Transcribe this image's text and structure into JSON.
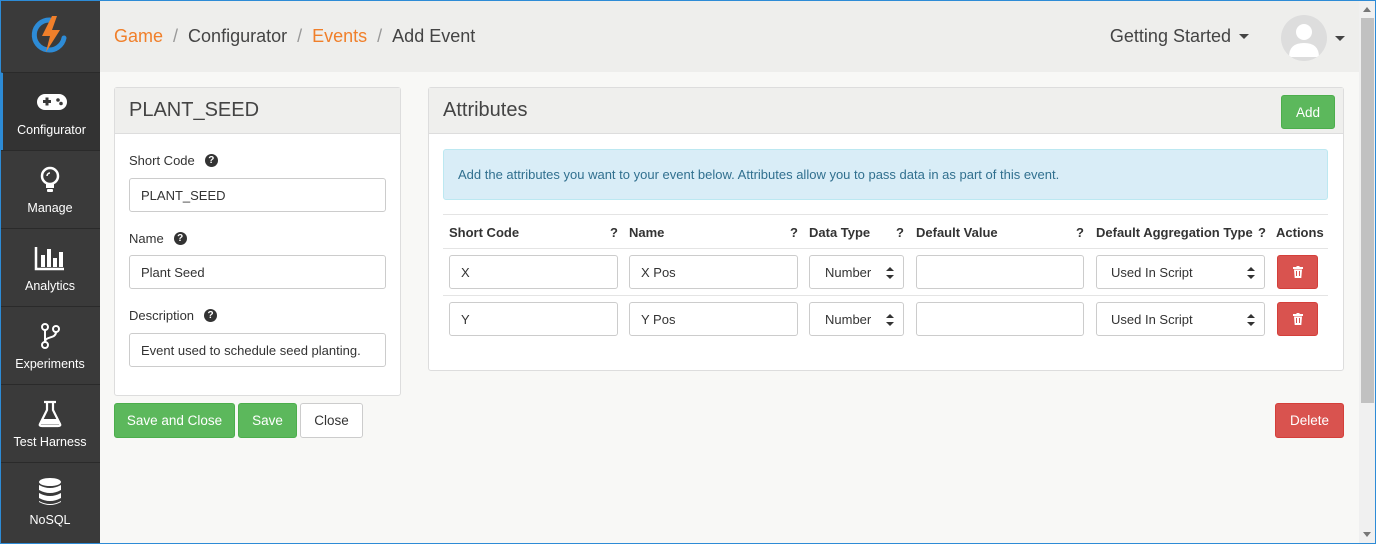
{
  "breadcrumb": {
    "items": [
      {
        "label": "Game"
      },
      {
        "label": "Configurator"
      },
      {
        "label": "Events"
      },
      {
        "label": "Add Event"
      }
    ],
    "separator": "/"
  },
  "header": {
    "getting_started": "Getting Started"
  },
  "sidebar": {
    "items": [
      {
        "label": "Configurator",
        "icon": "gamepad-icon",
        "active": true
      },
      {
        "label": "Manage",
        "icon": "lightbulb-icon"
      },
      {
        "label": "Analytics",
        "icon": "bar-chart-icon"
      },
      {
        "label": "Experiments",
        "icon": "branch-icon"
      },
      {
        "label": "Test Harness",
        "icon": "flask-icon"
      },
      {
        "label": "NoSQL",
        "icon": "database-icon"
      }
    ]
  },
  "event": {
    "title": "PLANT_SEED",
    "short_code_label": "Short Code",
    "short_code": "PLANT_SEED",
    "name_label": "Name",
    "name": "Plant Seed",
    "description_label": "Description",
    "description": "Event used to schedule seed planting."
  },
  "help_mark": "?",
  "actions": {
    "save_and_close": "Save and Close",
    "save": "Save",
    "close": "Close",
    "delete": "Delete"
  },
  "attributes": {
    "title": "Attributes",
    "add": "Add",
    "info": "Add the attributes you want to your event below. Attributes allow you to pass data in as part of this event.",
    "columns": [
      "Short Code",
      "Name",
      "Data Type",
      "Default Value",
      "Default Aggregation Type",
      "Actions"
    ],
    "rows": [
      {
        "short_code": "X",
        "name": "X Pos",
        "data_type": "Number",
        "default_value": "",
        "aggregation": "Used In Script"
      },
      {
        "short_code": "Y",
        "name": "Y Pos",
        "data_type": "Number",
        "default_value": "",
        "aggregation": "Used In Script"
      }
    ]
  },
  "colors": {
    "accent_orange": "#f07f2a",
    "primary_green": "#5cb85c",
    "danger_red": "#d9534f",
    "info_blue": "#d9edf7",
    "sidebar_bg": "#3a3a3a",
    "active_indicator": "#2d8bd6"
  }
}
